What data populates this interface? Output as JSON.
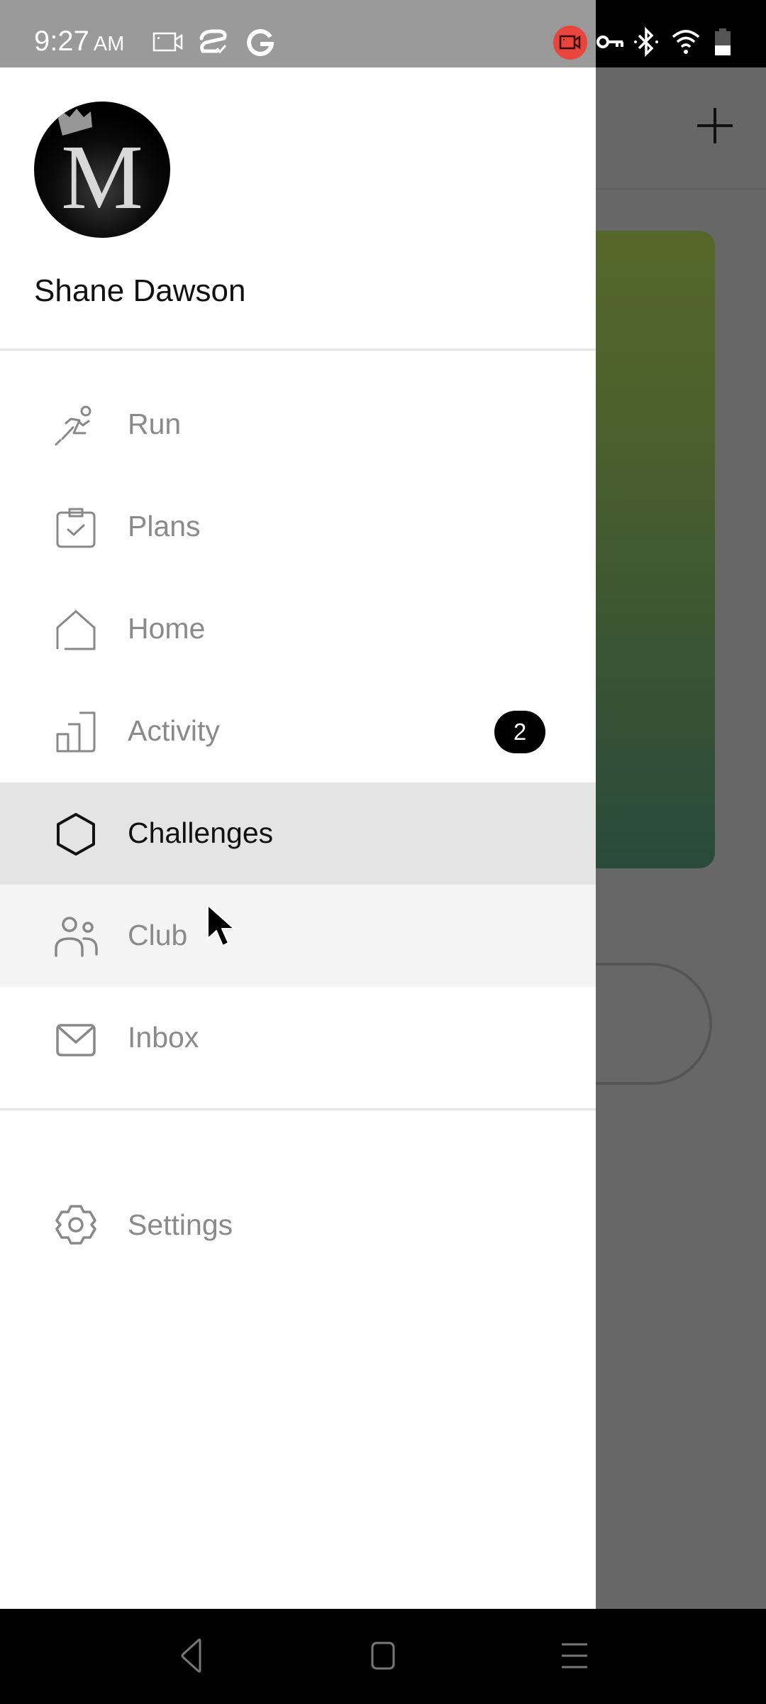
{
  "status_bar": {
    "time": "9:27",
    "ampm": "AM",
    "left_icons": [
      "screen-record-icon",
      "sync-icon",
      "google-icon"
    ],
    "right_icons": [
      "recording-active-icon",
      "vpn-key-icon",
      "bluetooth-icon",
      "wifi-icon",
      "battery-icon"
    ],
    "recording_color": "#e8453c"
  },
  "drawer": {
    "user": {
      "name": "Shane Dawson",
      "avatar_letter": "M"
    },
    "items": [
      {
        "label": "Run",
        "icon": "runner-icon",
        "active": false
      },
      {
        "label": "Plans",
        "icon": "clipboard-check-icon",
        "active": false
      },
      {
        "label": "Home",
        "icon": "home-icon",
        "active": false
      },
      {
        "label": "Activity",
        "icon": "bar-chart-icon",
        "active": false,
        "badge": "2"
      },
      {
        "label": "Challenges",
        "icon": "hexagon-icon",
        "active": true
      },
      {
        "label": "Club",
        "icon": "people-icon",
        "active": false
      },
      {
        "label": "Inbox",
        "icon": "mail-icon",
        "active": false
      }
    ],
    "settings": {
      "label": "Settings",
      "icon": "gear-icon"
    }
  },
  "background_app": {
    "add_icon": "plus-icon",
    "card_gradient": [
      "#55672a",
      "#2a4a3b"
    ]
  },
  "nav_bar": {
    "buttons": [
      "back-icon",
      "home-square-icon",
      "menu-lines-icon"
    ]
  }
}
